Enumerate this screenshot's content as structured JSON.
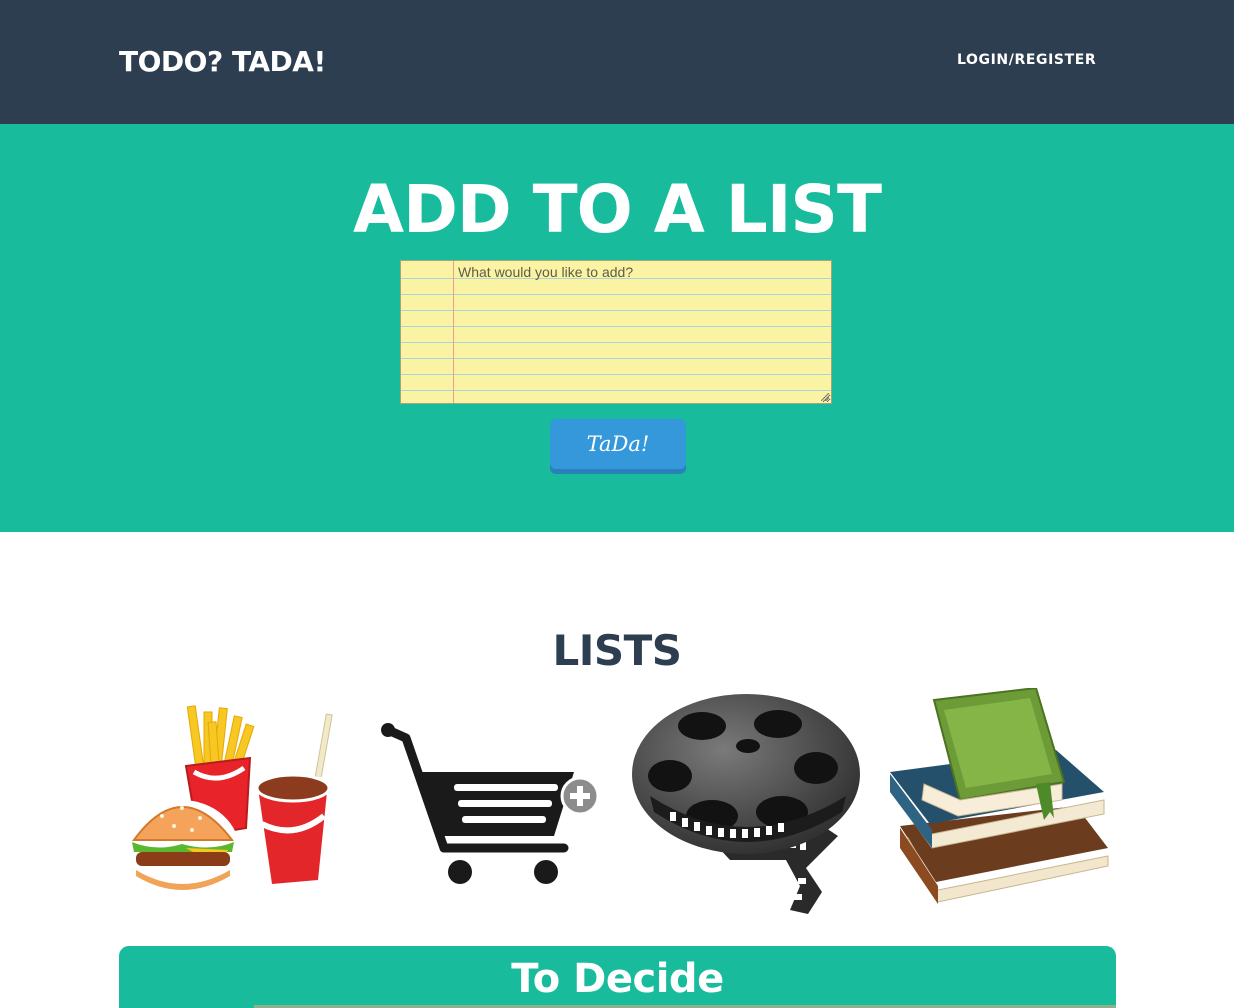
{
  "navbar": {
    "brand": "TODO? TADA!",
    "login_label": "LOGIN/REGISTER"
  },
  "hero": {
    "title": "ADD TO A LIST",
    "input_placeholder": "What would you like to add?",
    "submit_label": "TaDa!"
  },
  "lists": {
    "title": "LISTS",
    "icons": [
      "food-icon",
      "shopping-cart-icon",
      "film-reel-icon",
      "books-icon"
    ]
  },
  "decide": {
    "title": "To Decide"
  },
  "colors": {
    "navbar": "#2c3e50",
    "hero": "#18bc9c",
    "button": "#3498db",
    "notepad": "#faf3a4"
  }
}
